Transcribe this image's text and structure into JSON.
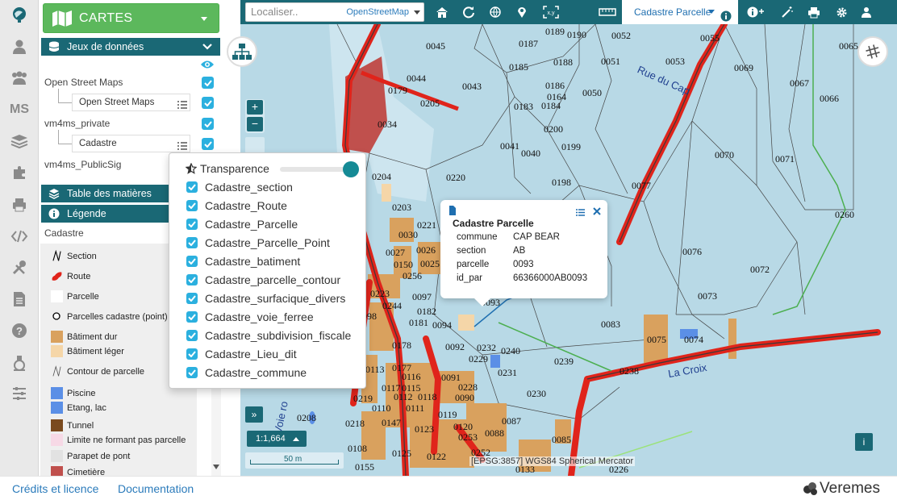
{
  "app": {
    "menu_title": "CARTES",
    "brand": "Veremes"
  },
  "side_panel": {
    "sections": {
      "datasets": "Jeux de données",
      "toc": "Table des matières",
      "legend": "Légende"
    },
    "layer_groups": [
      {
        "label": "Open Street Maps",
        "checked": true,
        "layers": [
          {
            "label": "Open Street Maps",
            "checked": true
          }
        ]
      },
      {
        "label": "vm4ms_private",
        "checked": true,
        "layers": [
          {
            "label": "Cadastre",
            "checked": true
          }
        ]
      },
      {
        "label": "vm4ms_PublicSig",
        "checked": false,
        "layers": []
      }
    ],
    "legend_title": "Cadastre",
    "legend_items": [
      {
        "label": "Section",
        "symbol": "line-black"
      },
      {
        "label": "Route",
        "symbol": "red-fill"
      },
      {
        "label": "Parcelle",
        "symbol": "none"
      },
      {
        "label": "Parcelles cadastre (point)",
        "symbol": "circle"
      },
      {
        "label": "Bâtiment dur",
        "symbol": "#d9a15e"
      },
      {
        "label": "Bâtiment léger",
        "symbol": "#f5d6a8"
      },
      {
        "label": "Contour de parcelle",
        "symbol": "line-grey"
      },
      {
        "label": "Piscine",
        "symbol": "#5b8fe6"
      },
      {
        "label": "Etang, lac",
        "symbol": "#5b8fe6"
      },
      {
        "label": "Tunnel",
        "symbol": "#7a4a1e"
      },
      {
        "label": "Limite ne formant pas parcelle",
        "symbol": "#f7d9e6"
      },
      {
        "label": "Parapet de pont",
        "symbol": "#e2e2e2"
      },
      {
        "label": "Cimetière",
        "symbol": "#c0504d"
      }
    ]
  },
  "toolbar": {
    "locate_placeholder": "Localiser..",
    "locate_source": "OpenStreetMap",
    "query_layer": "Cadastre Parcelle"
  },
  "layer_dropdown": {
    "transparency_label": "Transparence",
    "transparency_value": 1.0,
    "layers": [
      {
        "label": "Cadastre_section",
        "checked": true
      },
      {
        "label": "Cadastre_Route",
        "checked": true
      },
      {
        "label": "Cadastre_Parcelle",
        "checked": true
      },
      {
        "label": "Cadastre_Parcelle_Point",
        "checked": true
      },
      {
        "label": "Cadastre_batiment",
        "checked": true
      },
      {
        "label": "Cadastre_parcelle_contour",
        "checked": true
      },
      {
        "label": "Cadastre_surfacique_divers",
        "checked": true
      },
      {
        "label": "Cadastre_voie_ferree",
        "checked": true
      },
      {
        "label": "Cadastre_subdivision_fiscale",
        "checked": true
      },
      {
        "label": "Cadastre_Lieu_dit",
        "checked": true
      },
      {
        "label": "Cadastre_commune",
        "checked": true
      }
    ]
  },
  "feature_popup": {
    "title": "Cadastre Parcelle",
    "fields": [
      {
        "key": "commune",
        "value": "CAP BEAR"
      },
      {
        "key": "section",
        "value": "AB"
      },
      {
        "key": "parcelle",
        "value": "0093"
      },
      {
        "key": "id_par",
        "value": "66366000AB0093"
      }
    ]
  },
  "map": {
    "scale": "1:1,664",
    "scalebar": "50 m",
    "projection": "[EPSG:3857] WGS84 Spherical Mercator",
    "street_labels": [
      "Rue du Cap",
      "La Croix",
      "Voie ro"
    ],
    "parcel_labels": [
      {
        "t": "0045"
      },
      {
        "t": "0187"
      },
      {
        "t": "0189"
      },
      {
        "t": "0190"
      },
      {
        "t": "0052"
      },
      {
        "t": "0055"
      },
      {
        "t": "0065"
      },
      {
        "t": "0044"
      },
      {
        "t": "0179"
      },
      {
        "t": "0205"
      },
      {
        "t": "0043"
      },
      {
        "t": "0185"
      },
      {
        "t": "0188"
      },
      {
        "t": "0051"
      },
      {
        "t": "0053"
      },
      {
        "t": "0069"
      },
      {
        "t": "0186"
      },
      {
        "t": "0164"
      },
      {
        "t": "0050"
      },
      {
        "t": "0067"
      },
      {
        "t": "0066"
      },
      {
        "t": "0183"
      },
      {
        "t": "0184"
      },
      {
        "t": "0034"
      },
      {
        "t": "0200"
      },
      {
        "t": "0041"
      },
      {
        "t": "0040"
      },
      {
        "t": "0199"
      },
      {
        "t": "0070"
      },
      {
        "t": "0071"
      },
      {
        "t": "0204"
      },
      {
        "t": "0220"
      },
      {
        "t": "0198"
      },
      {
        "t": "0077"
      },
      {
        "t": "0203"
      },
      {
        "t": "0260"
      },
      {
        "t": "0030"
      },
      {
        "t": "0221"
      },
      {
        "t": "0027"
      },
      {
        "t": "0026"
      },
      {
        "t": "0076"
      },
      {
        "t": "0150"
      },
      {
        "t": "0025"
      },
      {
        "t": "0256"
      },
      {
        "t": "0072"
      },
      {
        "t": "0223"
      },
      {
        "t": "0097"
      },
      {
        "t": "0244"
      },
      {
        "t": "0093"
      },
      {
        "t": "0073"
      },
      {
        "t": "0182"
      },
      {
        "t": "0098"
      },
      {
        "t": "0181"
      },
      {
        "t": "0094"
      },
      {
        "t": "0083"
      },
      {
        "t": "0075"
      },
      {
        "t": "0074"
      },
      {
        "t": "0178"
      },
      {
        "t": "0092"
      },
      {
        "t": "0232"
      },
      {
        "t": "0240"
      },
      {
        "t": "0229"
      },
      {
        "t": "0231"
      },
      {
        "t": "0239"
      },
      {
        "t": "0177"
      },
      {
        "t": "0113"
      },
      {
        "t": "0116"
      },
      {
        "t": "0091"
      },
      {
        "t": "0238"
      },
      {
        "t": "0115"
      },
      {
        "t": "0117"
      },
      {
        "t": "0228"
      },
      {
        "t": "0230"
      },
      {
        "t": "0219"
      },
      {
        "t": "0112"
      },
      {
        "t": "0118"
      },
      {
        "t": "0090"
      },
      {
        "t": "0110"
      },
      {
        "t": "0111"
      },
      {
        "t": "0119"
      },
      {
        "t": "0208"
      },
      {
        "t": "0218"
      },
      {
        "t": "0147"
      },
      {
        "t": "0123"
      },
      {
        "t": "0120"
      },
      {
        "t": "0087"
      },
      {
        "t": "0253"
      },
      {
        "t": "0088"
      },
      {
        "t": "0085"
      },
      {
        "t": "0108"
      },
      {
        "t": "0125"
      },
      {
        "t": "0252"
      },
      {
        "t": "0122"
      },
      {
        "t": "0155"
      },
      {
        "t": "0133"
      },
      {
        "t": "0226"
      }
    ]
  },
  "footer": {
    "credits": "Crédits et licence",
    "documentation": "Documentation"
  },
  "colors": {
    "primary": "#1a6875",
    "accent": "#5cb85c",
    "checkbox": "#2bb0df",
    "road": "#e0241b"
  }
}
